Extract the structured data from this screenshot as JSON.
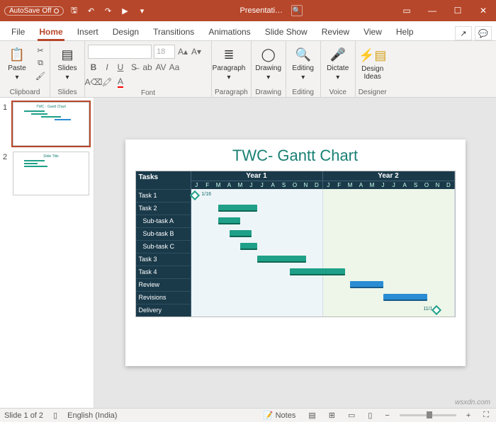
{
  "titlebar": {
    "autosave_label": "AutoSave",
    "autosave_state": "Off",
    "doc_name": "Presentati…"
  },
  "tabs": {
    "items": [
      "File",
      "Home",
      "Insert",
      "Design",
      "Transitions",
      "Animations",
      "Slide Show",
      "Review",
      "View",
      "Help"
    ],
    "active_index": 1
  },
  "ribbon": {
    "clipboard": {
      "paste": "Paste",
      "label": "Clipboard"
    },
    "slides": {
      "btn": "Slides",
      "label": "Slides"
    },
    "font": {
      "name_placeholder": "",
      "size_placeholder": "18",
      "label": "Font"
    },
    "paragraph": {
      "btn": "Paragraph",
      "label": "Paragraph"
    },
    "drawing": {
      "btn": "Drawing",
      "label": "Drawing"
    },
    "editing": {
      "btn": "Editing",
      "label": "Editing"
    },
    "voice": {
      "btn": "Dictate",
      "label": "Voice"
    },
    "designer": {
      "btn": "Design\nIdeas",
      "label": "Designer"
    }
  },
  "thumbs": {
    "items": [
      {
        "num": "1",
        "title": "TWC - Gantt Chart"
      },
      {
        "num": "2",
        "title": "Slide Title"
      }
    ],
    "active": 0
  },
  "slide": {
    "title": "TWC- Gantt Chart"
  },
  "chart_data": {
    "type": "bar",
    "title": "TWC- Gantt Chart",
    "x_axis": {
      "label": "",
      "groups": [
        "Year 1",
        "Year 2"
      ],
      "months": [
        "J",
        "F",
        "M",
        "A",
        "M",
        "J",
        "J",
        "A",
        "S",
        "O",
        "N",
        "D"
      ]
    },
    "task_header": "Tasks",
    "tasks": [
      {
        "name": "Task 1",
        "level": 0,
        "milestone": {
          "month_index": 0,
          "label": "1/16"
        }
      },
      {
        "name": "Task 2",
        "level": 0,
        "bar": {
          "start": 2.5,
          "end": 6.0,
          "color": "green"
        }
      },
      {
        "name": "Sub-task A",
        "level": 1,
        "bar": {
          "start": 2.5,
          "end": 4.5,
          "color": "green"
        }
      },
      {
        "name": "Sub-task B",
        "level": 1,
        "bar": {
          "start": 3.5,
          "end": 5.5,
          "color": "green"
        }
      },
      {
        "name": "Sub-task C",
        "level": 1,
        "bar": {
          "start": 4.5,
          "end": 6.0,
          "color": "green"
        }
      },
      {
        "name": "Task 3",
        "level": 0,
        "bar": {
          "start": 6.0,
          "end": 10.5,
          "color": "green"
        }
      },
      {
        "name": "Task 4",
        "level": 0,
        "bar": {
          "start": 9.0,
          "end": 14.0,
          "color": "green"
        }
      },
      {
        "name": "Review",
        "level": 0,
        "bar": {
          "start": 14.5,
          "end": 17.5,
          "color": "blue"
        }
      },
      {
        "name": "Revisions",
        "level": 0,
        "bar": {
          "start": 17.5,
          "end": 21.5,
          "color": "blue"
        }
      },
      {
        "name": "Delivery",
        "level": 0,
        "milestone": {
          "month_index": 22,
          "label": "11/1",
          "align": "right"
        }
      }
    ],
    "total_months": 24
  },
  "status": {
    "slide_pos": "Slide 1 of 2",
    "lang": "English (India)",
    "notes": "Notes"
  },
  "watermark": "wsxdn.com"
}
